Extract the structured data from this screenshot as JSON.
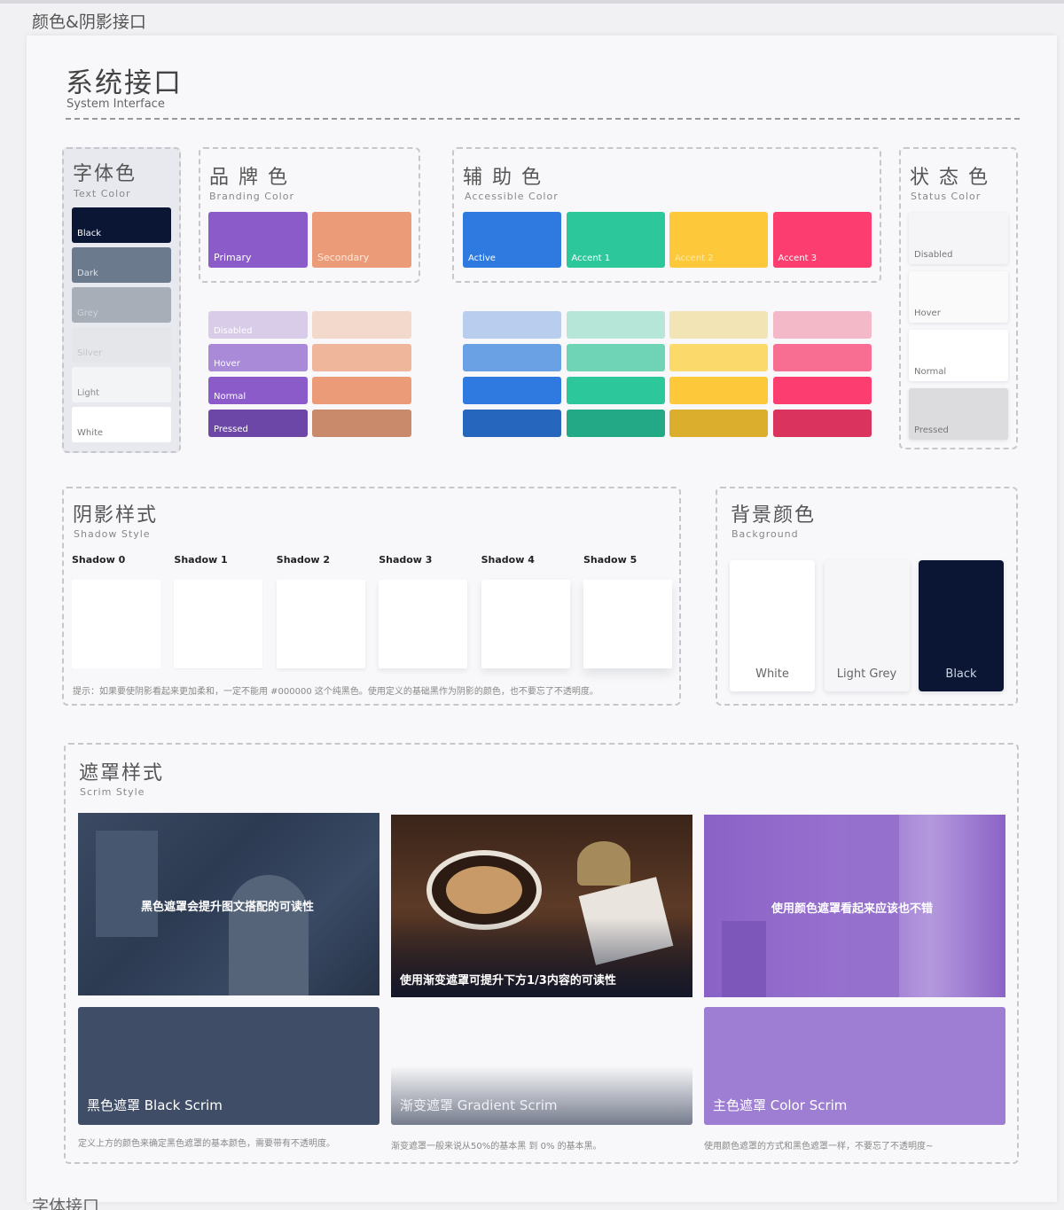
{
  "frame": {
    "title": "颜色&阴影接口",
    "next_title": "字体接口"
  },
  "header": {
    "title": "系统接口",
    "subtitle": "System Interface"
  },
  "text_color": {
    "title": "字体色",
    "subtitle": "Text Color",
    "swatches": [
      {
        "label": "Black",
        "color": "#0a1633",
        "text": "#ffffff"
      },
      {
        "label": "Dark",
        "color": "#6b7a8d",
        "text": "#dde3ea"
      },
      {
        "label": "Grey",
        "color": "#a7aeb8",
        "text": "#cfd3d8"
      },
      {
        "label": "Silver",
        "color": "#e4e6ea",
        "text": "#c2c6cc"
      },
      {
        "label": "Light",
        "color": "#f3f4f6",
        "text": "#888888"
      },
      {
        "label": "White",
        "color": "#ffffff",
        "text": "#777777"
      }
    ]
  },
  "branding": {
    "title": "品 牌 色",
    "subtitle": "Branding Color",
    "primary_label": "Primary",
    "secondary_label": "Secondary",
    "primary": "#8a5bc9",
    "secondary": "#ec9b78",
    "states": [
      {
        "label": "Disabled",
        "p": "#d8cce8",
        "s": "#f2d9cc"
      },
      {
        "label": "Hover",
        "p": "#a98ad8",
        "s": "#f0b69c"
      },
      {
        "label": "Normal",
        "p": "#8a5bc9",
        "s": "#ec9b78"
      },
      {
        "label": "Pressed",
        "p": "#6c47a7",
        "s": "#c98a6c"
      }
    ]
  },
  "accessible": {
    "title": "辅 助 色",
    "subtitle": "Accessible Color",
    "labels": [
      "Active",
      "Accent 1",
      "Accent 2",
      "Accent 3"
    ],
    "colors": [
      "#2f7ae0",
      "#2dc79c",
      "#fdc93a",
      "#fb3d6f"
    ],
    "states": [
      [
        "#b9cdee",
        "#b5e6d7",
        "#f2e4b4",
        "#f4b9c9"
      ],
      [
        "#6aa0e4",
        "#6fd4b6",
        "#fbd96a",
        "#f86e92"
      ],
      [
        "#2f7ae0",
        "#2dc79c",
        "#fdc93a",
        "#fb3d6f"
      ],
      [
        "#2766bd",
        "#23a985",
        "#dcae2e",
        "#d9335e"
      ]
    ]
  },
  "status": {
    "title": "状 态 色",
    "subtitle": "Status Color",
    "items": [
      {
        "label": "Disabled",
        "color": "#f5f5f7"
      },
      {
        "label": "Hover",
        "color": "#fafafb"
      },
      {
        "label": "Normal",
        "color": "#ffffff"
      },
      {
        "label": "Pressed",
        "color": "#dcdcde"
      }
    ]
  },
  "shadow": {
    "title": "阴影样式",
    "subtitle": "Shadow Style",
    "items": [
      "Shadow 0",
      "Shadow 1",
      "Shadow 2",
      "Shadow 3",
      "Shadow 4",
      "Shadow 5"
    ],
    "hint": "提示：如果要使阴影看起来更加柔和，一定不能用 #000000 这个纯黑色。使用定义的基础黑作为阴影的颜色，也不要忘了不透明度。"
  },
  "background": {
    "title": "背景颜色",
    "subtitle": "Background",
    "items": [
      {
        "label": "White",
        "color": "#ffffff",
        "text": "#666666"
      },
      {
        "label": "Light Grey",
        "color": "#f6f6f8",
        "text": "#666666"
      },
      {
        "label": "Black",
        "color": "#0a1633",
        "text": "#cfd6e4"
      }
    ]
  },
  "scrim": {
    "title": "遮罩样式",
    "subtitle": "Scrim Style",
    "images": [
      "黑色遮罩会提升图文搭配的可读性",
      "使用渐变遮罩可提升下方1/3内容的可读性",
      "使用颜色遮罩看起来应该也不错"
    ],
    "cards": [
      {
        "label": "黑色遮罩  Black Scrim",
        "note": "定义上方的颜色来确定黑色遮罩的基本颜色，需要带有不透明度。"
      },
      {
        "label": "渐变遮罩 Gradient Scrim",
        "note": "渐变遮罩一般来说从50%的基本黑 到 0% 的基本黑。"
      },
      {
        "label": "主色遮罩 Color Scrim",
        "note": "使用颜色遮罩的方式和黑色遮罩一样，不要忘了不透明度~"
      }
    ]
  }
}
